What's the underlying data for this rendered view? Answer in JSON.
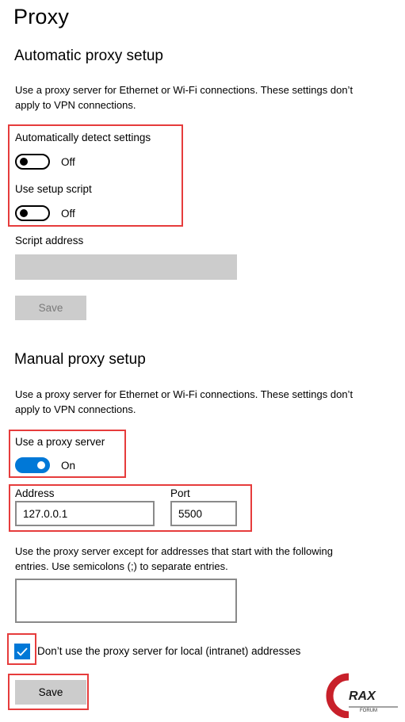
{
  "page": {
    "title": "Proxy"
  },
  "automatic": {
    "heading": "Automatic proxy setup",
    "description": "Use a proxy server for Ethernet or Wi-Fi connections. These settings don’t apply to VPN connections.",
    "detect_label": "Automatically detect settings",
    "detect_state": "Off",
    "script_label": "Use setup script",
    "script_state": "Off",
    "script_address_label": "Script address",
    "script_address_value": "",
    "save_label": "Save"
  },
  "manual": {
    "heading": "Manual proxy setup",
    "description": "Use a proxy server for Ethernet or Wi-Fi connections. These settings don’t apply to VPN connections.",
    "use_proxy_label": "Use a proxy server",
    "use_proxy_state": "On",
    "address_label": "Address",
    "address_value": "127.0.0.1",
    "port_label": "Port",
    "port_value": "5500",
    "exceptions_description": "Use the proxy server except for addresses that start with the following entries. Use semicolons (;) to separate entries.",
    "exceptions_value": "",
    "local_checkbox_label": "Don’t use the proxy server for local (intranet) addresses",
    "local_checkbox_checked": true,
    "save_label": "Save"
  },
  "watermark": {
    "text": "RAX",
    "subtext": "FORUM"
  },
  "colors": {
    "accent": "#0078d7",
    "highlight": "#e63c3c",
    "disabled": "#cccccc"
  }
}
